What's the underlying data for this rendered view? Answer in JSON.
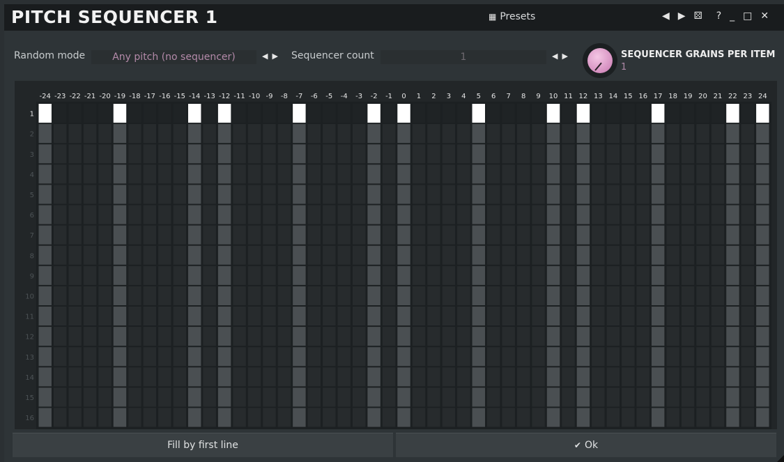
{
  "window": {
    "title": "PITCH SEQUENCER 1",
    "presets_label": "Presets",
    "controls": {
      "prev": "◀",
      "next": "▶",
      "random": "⚄",
      "help": "?",
      "minimize": "_",
      "maximize": "□",
      "close": "✕"
    }
  },
  "controls": {
    "random_mode_label": "Random mode",
    "random_mode_value": "Any pitch (no sequencer)",
    "sequencer_count_label": "Sequencer count",
    "sequencer_count_value": "1",
    "arrow_left": "◀",
    "arrow_right": "▶",
    "grains_label": "SEQUENCER GRAINS PER ITEM",
    "grains_value": "1",
    "knob_level": 0.05
  },
  "grid": {
    "columns": [
      "-24",
      "-23",
      "-22",
      "-21",
      "-20",
      "-19",
      "-18",
      "-17",
      "-16",
      "-15",
      "-14",
      "-13",
      "-12",
      "-11",
      "-10",
      "-9",
      "-8",
      "-7",
      "-6",
      "-5",
      "-4",
      "-3",
      "-2",
      "-1",
      "0",
      "1",
      "2",
      "3",
      "4",
      "5",
      "6",
      "7",
      "8",
      "9",
      "10",
      "11",
      "12",
      "13",
      "14",
      "15",
      "16",
      "17",
      "18",
      "19",
      "20",
      "21",
      "22",
      "23",
      "24"
    ],
    "rows": [
      "1",
      "2",
      "3",
      "4",
      "5",
      "6",
      "7",
      "8",
      "9",
      "10",
      "11",
      "12",
      "13",
      "14",
      "15",
      "16"
    ],
    "active_columns": [
      "-24",
      "-19",
      "-14",
      "-12",
      "-7",
      "-2",
      "0",
      "5",
      "10",
      "12",
      "17",
      "22",
      "24"
    ],
    "colors": {
      "active": "#ffffff",
      "inactive_stripe": "#4a4f52",
      "cell": "#272b2d",
      "panel": "#222628"
    }
  },
  "buttons": {
    "fill": "Fill by first line",
    "ok": "Ok"
  }
}
